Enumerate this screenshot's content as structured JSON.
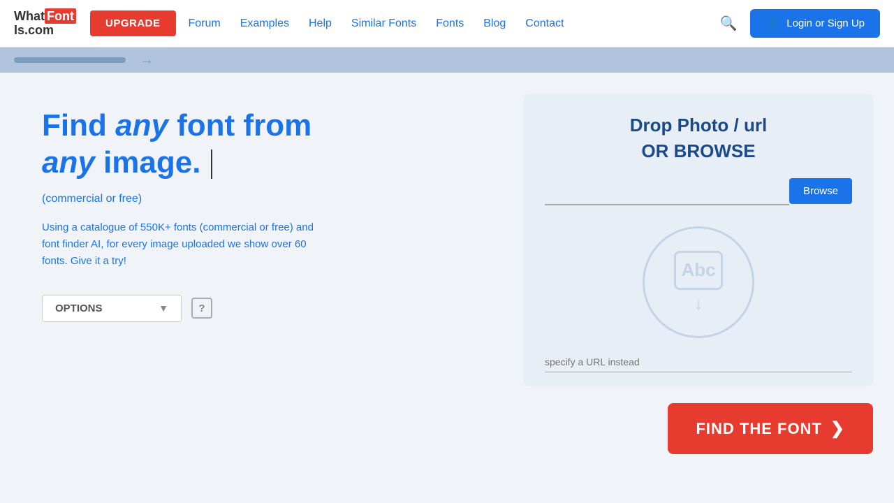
{
  "header": {
    "logo_what": "What",
    "logo_font": "Font",
    "logo_is": "Is.com",
    "upgrade_label": "UPGRADE",
    "nav_items": [
      {
        "label": "Forum",
        "href": "#"
      },
      {
        "label": "Examples",
        "href": "#"
      },
      {
        "label": "Help",
        "href": "#"
      },
      {
        "label": "Similar Fonts",
        "href": "#"
      },
      {
        "label": "Fonts",
        "href": "#"
      },
      {
        "label": "Blog",
        "href": "#"
      },
      {
        "label": "Contact",
        "href": "#"
      }
    ],
    "login_label": "Login or Sign Up"
  },
  "hero": {
    "title_find": "Find ",
    "title_any1": "any",
    "title_font": " font from",
    "title_any2": "any",
    "title_image": " image.",
    "subtitle": "(commercial or free)",
    "description": "Using a catalogue of 550K+ fonts (commercial or free) and font finder AI, for every image uploaded we show over 60 fonts. Give it a try!",
    "options_label": "OPTIONS",
    "help_label": "?"
  },
  "dropzone": {
    "title": "Drop Photo / url",
    "or_browse": "OR BROWSE",
    "browse_placeholder": "",
    "browse_button": "Browse",
    "url_placeholder": "specify a URL instead"
  },
  "cta": {
    "find_font_label": "FIND THE FONT",
    "arrow": "❯"
  },
  "colors": {
    "blue_primary": "#1a73e8",
    "red_primary": "#e63b2e",
    "dark_blue": "#1a4a8a",
    "light_blue_bg": "#e8eef5",
    "banner_bg": "#b0c4de"
  }
}
